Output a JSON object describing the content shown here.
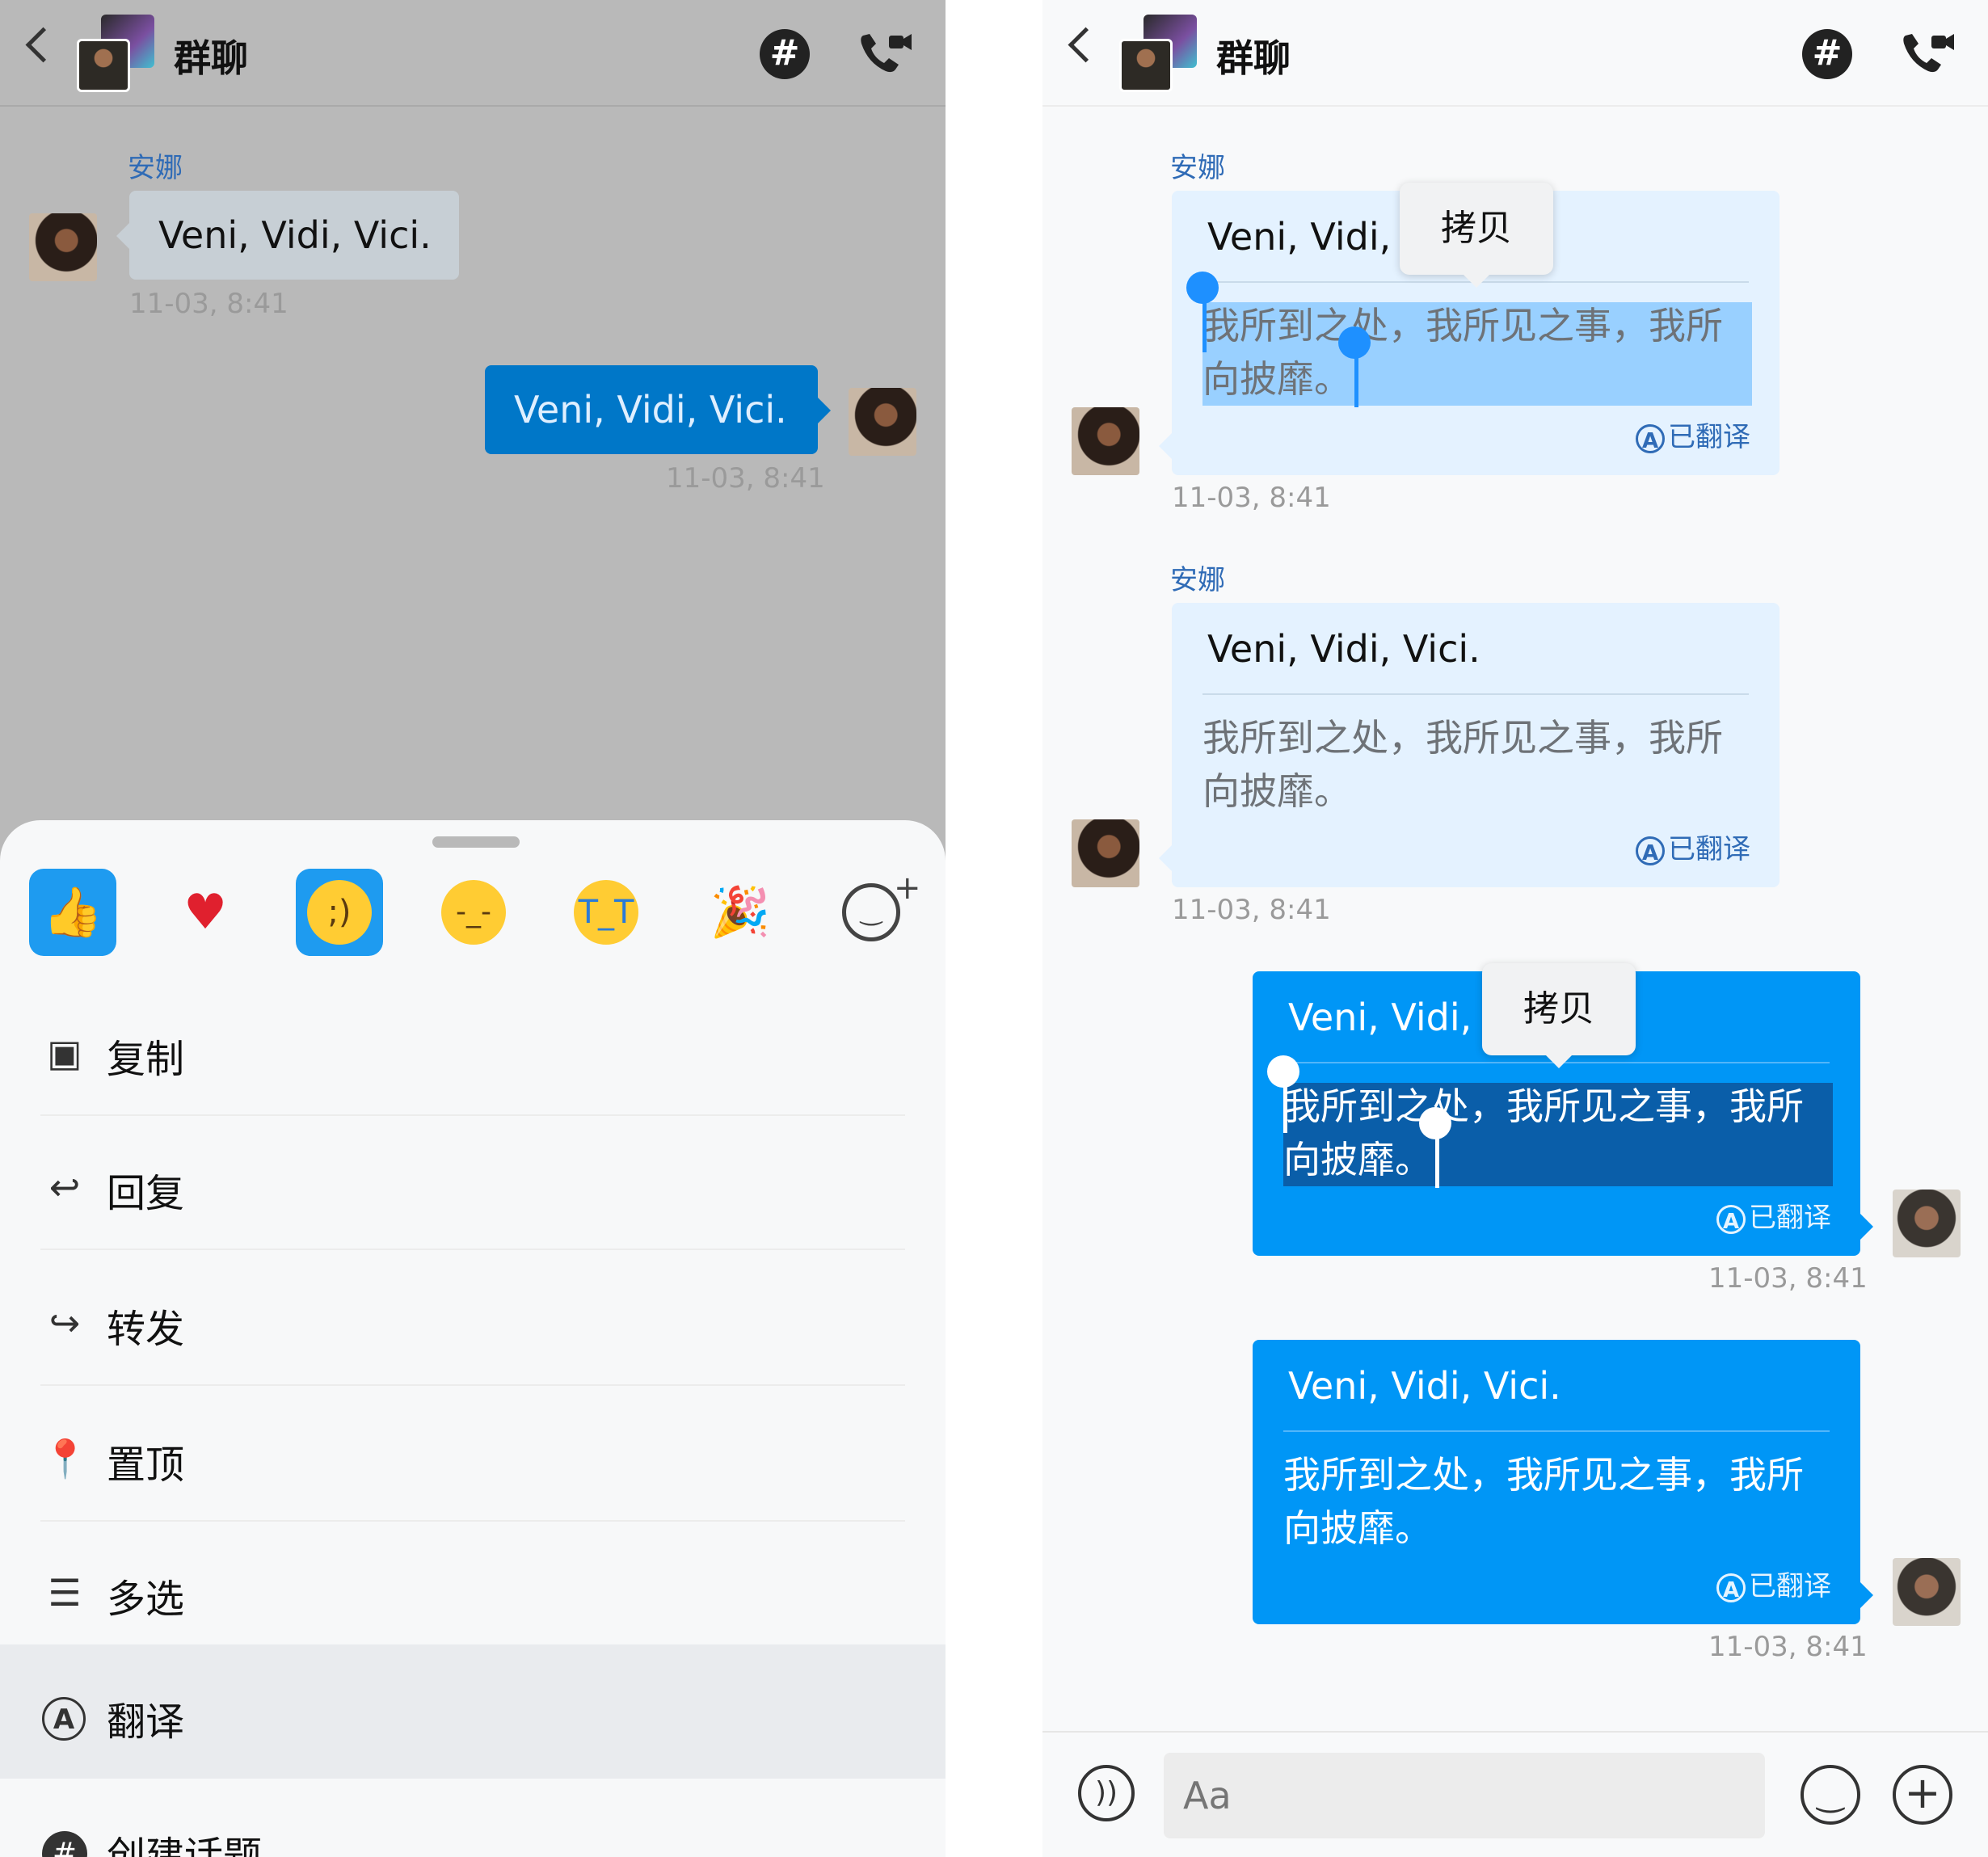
{
  "left": {
    "header": {
      "title": "群聊"
    },
    "messages": [
      {
        "sender": "安娜",
        "text": "Veni, Vidi, Vici.",
        "time": "11-03, 8:41"
      },
      {
        "text": "Veni, Vidi, Vici.",
        "time": "11-03, 8:41"
      }
    ],
    "reactions": [
      "thumbs-up",
      "heart",
      "winking-face",
      "face-with-raised-eyebrow",
      "loudly-crying-face",
      "party-popper",
      "add-reaction"
    ],
    "menu": [
      "复制",
      "回复",
      "转发",
      "置顶",
      "多选",
      "翻译",
      "创建话题"
    ]
  },
  "right": {
    "header": {
      "title": "群聊"
    },
    "messages": [
      {
        "sender": "安娜",
        "original": "Veni, Vidi,",
        "translation": "我所到之处，我所见之事，我所向披靡。",
        "tag": "已翻译",
        "time": "11-03, 8:41",
        "popup": "拷贝"
      },
      {
        "sender": "安娜",
        "original": "Veni, Vidi, Vici.",
        "translation": "我所到之处，我所见之事，我所向披靡。",
        "tag": "已翻译",
        "time": "11-03, 8:41"
      },
      {
        "original": "Veni, Vidi,",
        "translation": "我所到之处，我所见之事，我所向披靡。",
        "tag": "已翻译",
        "time": "11-03, 8:41",
        "popup": "拷贝"
      },
      {
        "original": "Veni, Vidi, Vici.",
        "translation": "我所到之处，我所见之事，我所向披靡。",
        "tag": "已翻译",
        "time": "11-03, 8:41"
      }
    ],
    "composer": {
      "placeholder": "Aa"
    }
  },
  "colors": {
    "outgoing": "#0096f6",
    "incoming": "#e4f2ff",
    "accent": "#1e90ff",
    "sender": "#2f6bb6"
  }
}
